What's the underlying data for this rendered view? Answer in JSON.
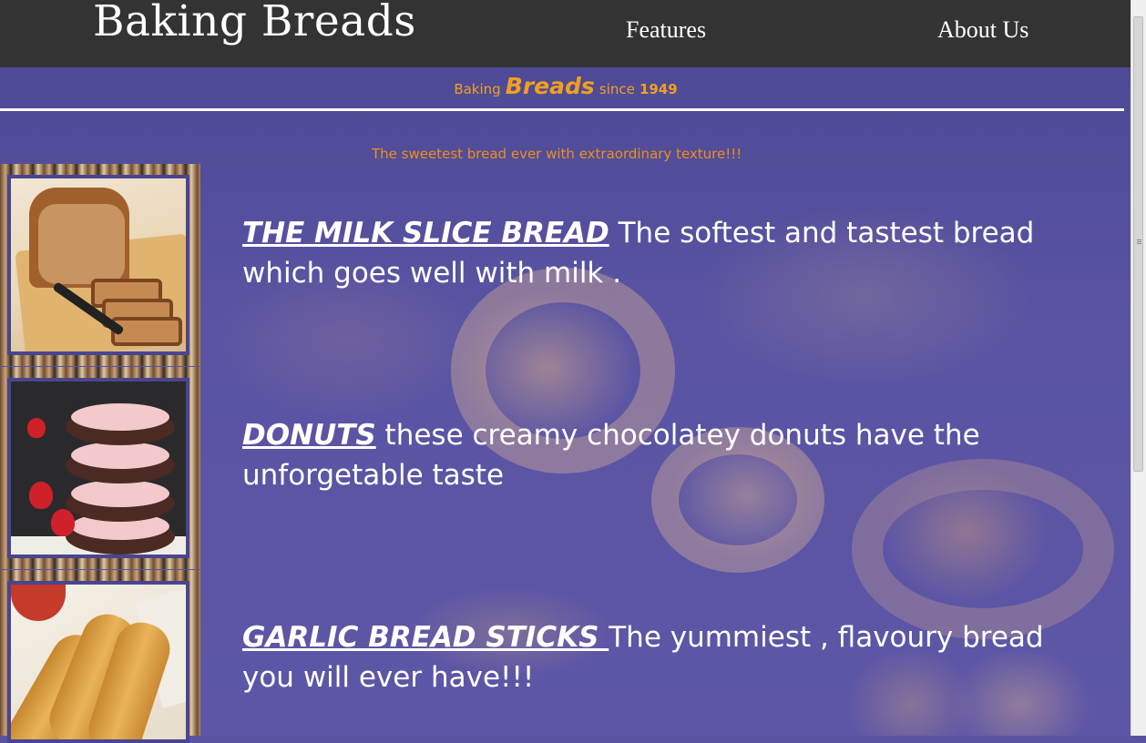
{
  "header": {
    "brand": "Baking Breads",
    "nav": [
      {
        "label": "Features"
      },
      {
        "label": "About Us"
      }
    ]
  },
  "tagline": {
    "prefix": "Baking",
    "highlight": "Breads",
    "suffix": "since",
    "year": "1949"
  },
  "subtagline": "The sweetest bread ever with extraordinary texture!!!",
  "products": [
    {
      "name": "THE MILK SLICE BREAD",
      "description": " The softest and tastest bread which goes well with milk ."
    },
    {
      "name": "DONUTS",
      "description": " these creamy chocolatey donuts have the unforgetable taste"
    },
    {
      "name": "GARLIC BREAD STICKS ",
      "description": "The yummiest , flavoury bread you will ever have!!!"
    }
  ],
  "colors": {
    "header_bg": "#333333",
    "accent_orange": "#f0a020",
    "overlay_purple": "#5a54a0",
    "text_white": "#ffffff"
  }
}
